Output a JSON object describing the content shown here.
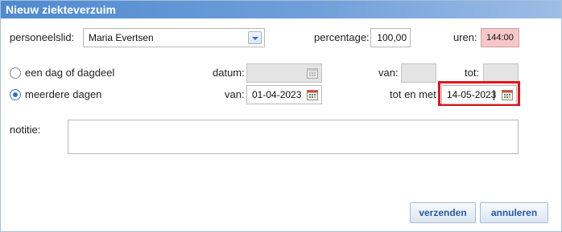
{
  "window": {
    "title": "Nieuw ziekteverzuim"
  },
  "form": {
    "employee_label": "personeelslid:",
    "employee_value": "Maria Evertsen",
    "percentage_label": "percentage:",
    "percentage_value": "100,00",
    "hours_label": "uren:",
    "hours_value": "144:00",
    "single_day_label": "een dag of dagdeel",
    "date_label": "datum:",
    "date_value": "",
    "from_time_label": "van:",
    "from_time_value": "",
    "to_time_label": "tot:",
    "to_time_value": "",
    "multi_day_label": "meerdere dagen",
    "from_date_label": "van:",
    "from_date_value": "01-04-2023",
    "to_date_label": "tot en met",
    "to_date_value": "14-05-2023",
    "note_label": "notitie:",
    "note_value": ""
  },
  "buttons": {
    "submit": "verzenden",
    "cancel": "annuleren"
  },
  "state": {
    "selected_option": "meerdere dagen"
  },
  "colors": {
    "title_bar": "#4f8ad0",
    "highlight": "#e4141b",
    "hours_bg": "#f6c6c8"
  }
}
